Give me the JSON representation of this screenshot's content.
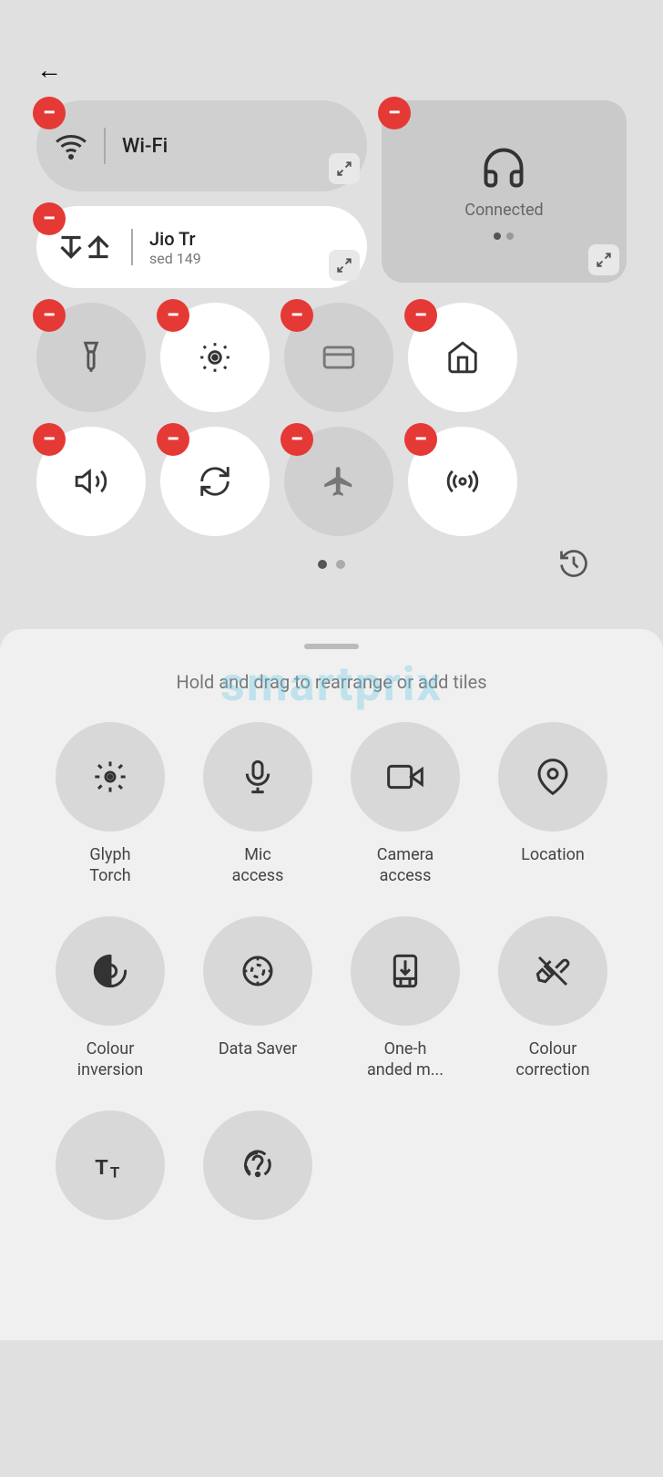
{
  "back_button": "←",
  "wifi": {
    "icon": "wifi",
    "label": "Wi-Fi"
  },
  "headphone": {
    "connected": "Connected"
  },
  "data": {
    "label": "Jio Tr",
    "sub": "sed   149"
  },
  "hint": "Hold and drag to rearrange or add tiles",
  "page_dots": [
    "active",
    "inactive"
  ],
  "icon_rows": [
    [
      {
        "id": "flashlight",
        "active": false,
        "symbol": "🔦"
      },
      {
        "id": "auto-brightness",
        "active": true,
        "symbol": "☀"
      },
      {
        "id": "wallet",
        "active": false,
        "symbol": "💳"
      },
      {
        "id": "home-control",
        "active": true,
        "symbol": "🏠"
      }
    ],
    [
      {
        "id": "volume",
        "active": true,
        "symbol": "🔊"
      },
      {
        "id": "rotate",
        "active": true,
        "symbol": "🔄"
      },
      {
        "id": "airplane",
        "active": false,
        "symbol": "✈"
      },
      {
        "id": "hotspot",
        "active": true,
        "symbol": "📡"
      }
    ]
  ],
  "add_tiles": [
    {
      "id": "glyph-torch",
      "label": "Glyph\nTorch",
      "icon": "glyph"
    },
    {
      "id": "mic-access",
      "label": "Mic\naccess",
      "icon": "mic"
    },
    {
      "id": "camera-access",
      "label": "Camera\naccess",
      "icon": "camera"
    },
    {
      "id": "location",
      "label": "Location",
      "icon": "location"
    },
    {
      "id": "colour-inversion",
      "label": "Colour\ninversion",
      "icon": "inversion"
    },
    {
      "id": "data-saver",
      "label": "Data Saver",
      "icon": "datasaver"
    },
    {
      "id": "one-handed",
      "label": "One-h\nanded m...",
      "icon": "onehanded"
    },
    {
      "id": "colour-correction",
      "label": "Colour\ncorrection",
      "icon": "colourcorrection"
    },
    {
      "id": "font-size",
      "label": "",
      "icon": "fontsize"
    },
    {
      "id": "hearing",
      "label": "",
      "icon": "hearing"
    }
  ],
  "watermark": "smartprix"
}
